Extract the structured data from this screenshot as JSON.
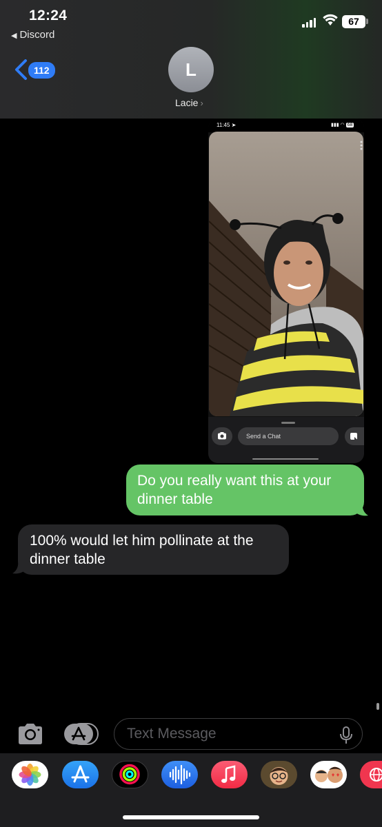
{
  "status_bar": {
    "time": "12:24",
    "back_app": "Discord",
    "battery": "67"
  },
  "header": {
    "unread_count": "112",
    "avatar_initial": "L",
    "contact_name": "Lacie"
  },
  "snapchat_screenshot": {
    "time": "11:45",
    "battery": "68",
    "send_chat_placeholder": "Send a Chat"
  },
  "messages": [
    {
      "direction": "outgoing",
      "text": "Do you really want this at your dinner table"
    },
    {
      "direction": "incoming",
      "text": "100% would let him pollinate at the dinner table"
    }
  ],
  "input": {
    "placeholder": "Text Message"
  },
  "app_drawer": {
    "apps": [
      "photos-icon",
      "app-store-icon",
      "activity-icon",
      "audio-message-icon",
      "music-icon",
      "memoji-icon",
      "memoji-stickers-icon",
      "web-search-icon"
    ]
  },
  "colors": {
    "outgoing_bubble": "#65c466",
    "incoming_bubble": "#262628",
    "badge": "#2f7cf6"
  }
}
